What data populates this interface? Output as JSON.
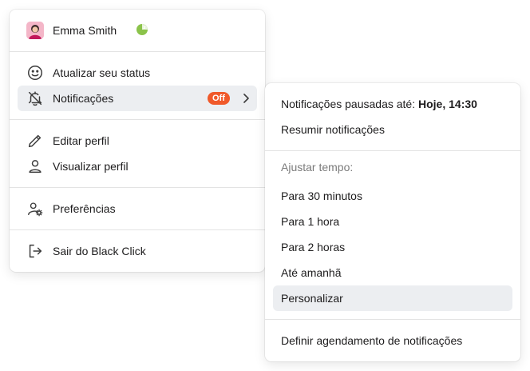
{
  "user": {
    "name": "Emma Smith",
    "status_icon": "paused-clock-icon"
  },
  "main_menu": {
    "update_status": "Atualizar seu status",
    "notifications": "Notificações",
    "notifications_badge": "Off",
    "edit_profile": "Editar perfil",
    "view_profile": "Visualizar perfil",
    "preferences": "Preferências",
    "sign_out": "Sair do Black Click"
  },
  "submenu": {
    "paused_label": "Notificações pausadas até:",
    "paused_until": "Hoje, 14:30",
    "resume": "Resumir notificações",
    "adjust_header": "Ajustar tempo:",
    "options": [
      "Para 30 minutos",
      "Para 1 hora",
      "Para 2 horas",
      "Até amanhã",
      "Personalizar"
    ],
    "schedule": "Definir agendamento de notificações"
  },
  "colors": {
    "badge": "#f0592a",
    "highlight": "#eceef1",
    "status": "#8bc34a"
  }
}
